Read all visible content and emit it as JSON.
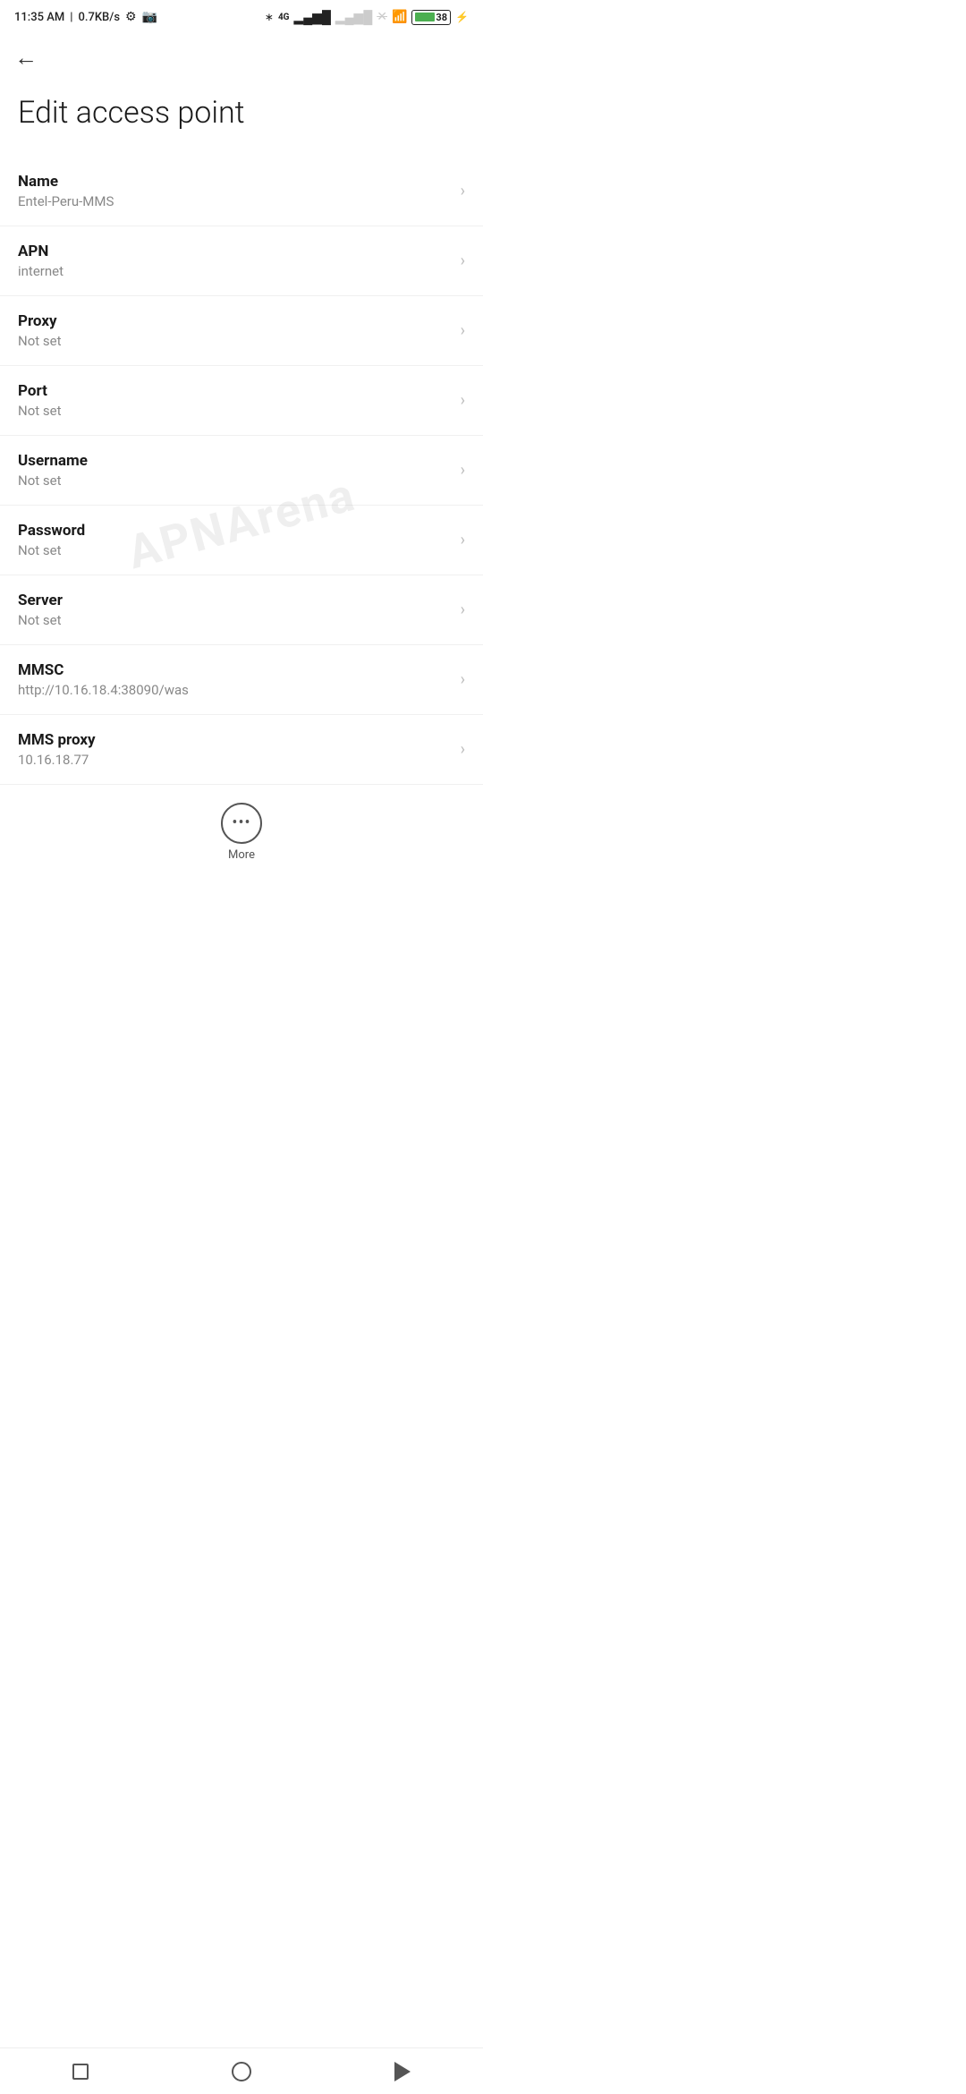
{
  "statusBar": {
    "time": "11:35 AM",
    "networkSpeed": "0.7KB/s",
    "batteryPercent": "38"
  },
  "header": {
    "backLabel": "←",
    "title": "Edit access point"
  },
  "settings": [
    {
      "label": "Name",
      "value": "Entel-Peru-MMS"
    },
    {
      "label": "APN",
      "value": "internet"
    },
    {
      "label": "Proxy",
      "value": "Not set"
    },
    {
      "label": "Port",
      "value": "Not set"
    },
    {
      "label": "Username",
      "value": "Not set"
    },
    {
      "label": "Password",
      "value": "Not set"
    },
    {
      "label": "Server",
      "value": "Not set"
    },
    {
      "label": "MMSC",
      "value": "http://10.16.18.4:38090/was"
    },
    {
      "label": "MMS proxy",
      "value": "10.16.18.77"
    }
  ],
  "more": {
    "label": "More"
  },
  "watermark": "APNArena"
}
